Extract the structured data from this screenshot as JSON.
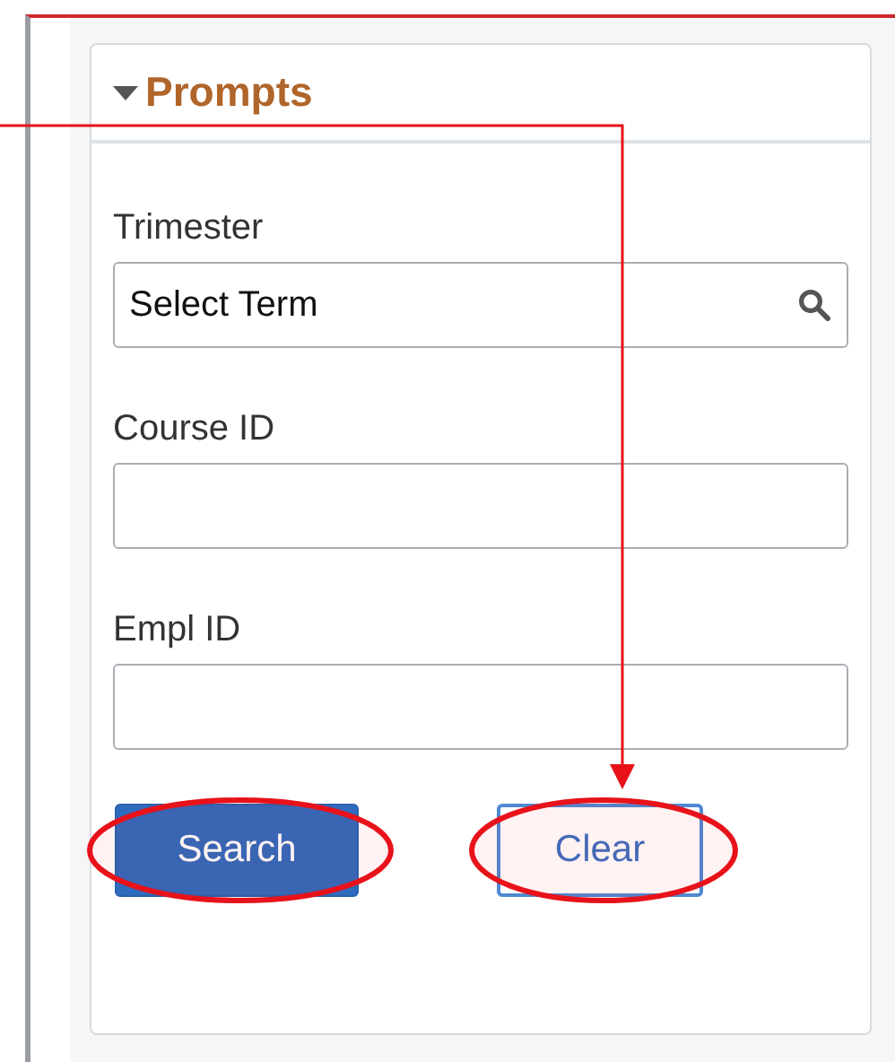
{
  "callout_arrow": true,
  "panel": {
    "title": "Prompts",
    "expanded": true,
    "fields": [
      {
        "label": "Trimester",
        "value": "Select Term",
        "kind": "lookup"
      },
      {
        "label": "Course ID",
        "kind": "text"
      },
      {
        "label": "Empl ID",
        "kind": "text"
      }
    ],
    "buttons": [
      {
        "label": "Search",
        "kind": "primary",
        "circled": true
      },
      {
        "label": "Clear",
        "kind": "secondary",
        "circled": true
      }
    ]
  }
}
